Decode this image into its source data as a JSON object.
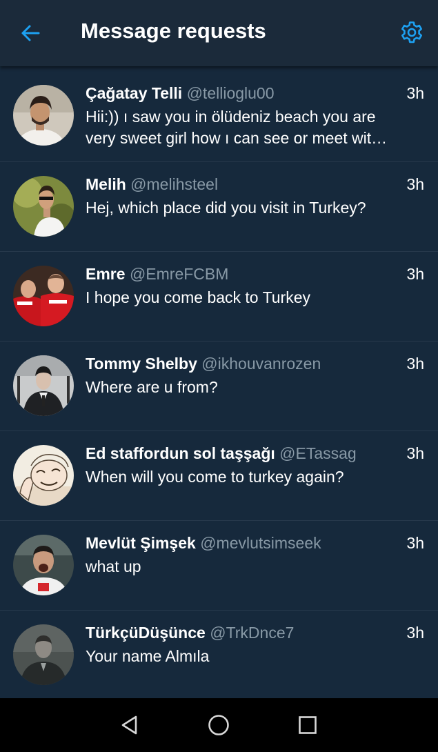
{
  "header": {
    "title": "Message requests",
    "back_icon": "arrow-left-icon",
    "settings_icon": "gear-icon",
    "accent_color": "#1da1f2"
  },
  "messages": [
    {
      "name": "Çağatay Telli",
      "handle": "@tellioglu00",
      "time": "3h",
      "text": "Hii:)) ı saw you in ölüdeniz beach you are very sweet girl how ı can see or meet wit…"
    },
    {
      "name": "Melih",
      "handle": "@melihsteel",
      "time": "3h",
      "text": "Hej, which place did you visit in Turkey?"
    },
    {
      "name": "Emre",
      "handle": "@EmreFCBM",
      "time": "3h",
      "text": "I hope you come back to Turkey"
    },
    {
      "name": "Tommy Shelby",
      "handle": "@ikhouvanrozen",
      "time": "3h",
      "text": "Where are u from?"
    },
    {
      "name": "Ed staffordun sol taşşağı",
      "handle": "@ETassag",
      "time": "3h",
      "text": "When will you come to turkey again?"
    },
    {
      "name": "Mevlüt Şimşek",
      "handle": "@mevlutsimseek",
      "time": "3h",
      "text": "what up"
    },
    {
      "name": "TürkçüDüşünce",
      "handle": "@TrkDnce7",
      "time": "3h",
      "text": "Your name Almıla"
    }
  ],
  "navbar": {
    "back_icon": "triangle-back-icon",
    "home_icon": "circle-home-icon",
    "recents_icon": "square-recents-icon"
  }
}
